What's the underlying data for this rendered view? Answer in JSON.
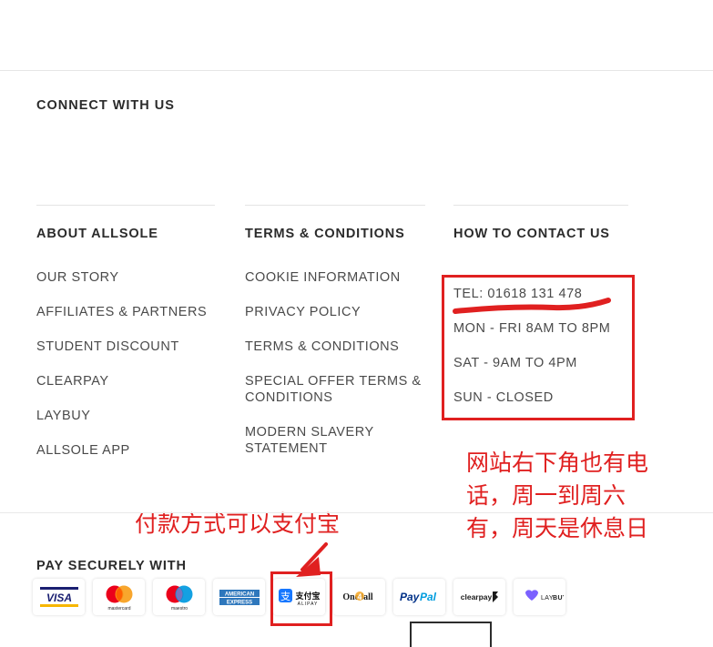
{
  "connect": {
    "title": "CONNECT WITH US"
  },
  "columns": [
    {
      "heading": "ABOUT ALLSOLE",
      "links": [
        "OUR STORY",
        "AFFILIATES & PARTNERS",
        "STUDENT DISCOUNT",
        "CLEARPAY",
        "LAYBUY",
        "ALLSOLE APP"
      ]
    },
    {
      "heading": "TERMS & CONDITIONS",
      "links": [
        "COOKIE INFORMATION",
        "PRIVACY POLICY",
        "TERMS & CONDITIONS",
        "SPECIAL OFFER TERMS & CONDITIONS",
        "MODERN SLAVERY STATEMENT"
      ]
    },
    {
      "heading": "HOW TO CONTACT US",
      "links": []
    }
  ],
  "contact": {
    "phone": "TEL: 01618 131 478",
    "hours_weekday": "MON - FRI 8AM TO 8PM",
    "hours_saturday": "SAT - 9AM TO 4PM",
    "hours_sunday": "SUN - CLOSED"
  },
  "annotations": {
    "color": "#e02020",
    "contact_note": "网站右下角也有电\n话，周一到周六\n有，周天是休息日",
    "payment_note": "付款方式可以支付宝"
  },
  "payment": {
    "title": "PAY SECURELY WITH",
    "methods": [
      {
        "name": "visa",
        "label": "VISA"
      },
      {
        "name": "mastercard",
        "label": "mastercard"
      },
      {
        "name": "maestro",
        "label": "maestro"
      },
      {
        "name": "american-express",
        "label": "AMERICAN EXPRESS"
      },
      {
        "name": "alipay",
        "label": "支付宝 ALIPAY"
      },
      {
        "name": "one4all",
        "label": "One4all"
      },
      {
        "name": "paypal",
        "label": "PayPal"
      },
      {
        "name": "clearpay",
        "label": "clearpay"
      },
      {
        "name": "laybuy",
        "label": "LAYBUY"
      }
    ]
  }
}
